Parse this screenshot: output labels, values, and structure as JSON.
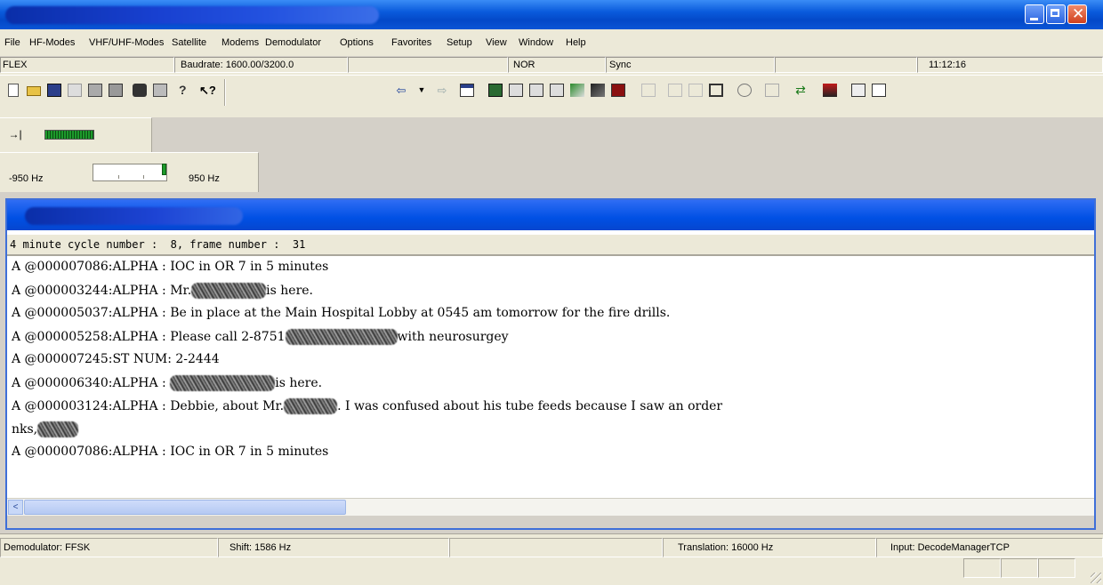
{
  "window": {
    "min_label": "minimize",
    "max_label": "maximize",
    "close_label": "close",
    "close_glyph": "✕"
  },
  "menu": [
    "File",
    "HF-Modes",
    "VHF/UHF-Modes",
    "Satellite",
    "Modems",
    "Demodulator",
    "Options",
    "Favorites",
    "Setup",
    "View",
    "Window",
    "Help"
  ],
  "strip": {
    "mode": "FLEX",
    "baudrate": "Baudrate: 1600.00/3200.0",
    "polarity": "NOR",
    "sync": "Sync",
    "time": "11:12:16"
  },
  "tuner": {
    "low": "-950 Hz",
    "high": "950 Hz",
    "position": 1.0
  },
  "decoder": {
    "info": "4 minute cycle number :  8, frame number :  31",
    "lines": [
      "A @000007086:ALPHA : IOC in OR 7 in 5 minutes",
      "A @000003244:ALPHA : Mr.",
      "A @000005037:ALPHA : Be in place at the Main Hospital Lobby at 0545 am tomorrow for the fire drills.",
      "A @000005258:ALPHA : Please call 2-8751",
      "A @000007245:ST NUM: 2-2444",
      "A @000006340:ALPHA : ",
      "A @000003124:ALPHA : Debbie, about Mr.",
      "nks,",
      "A @000007086:ALPHA : IOC in OR 7 in 5 minutes"
    ],
    "suffixes": {
      "l1": "is here.",
      "l3": "with neurosurgey",
      "l5": "is here.",
      "l6": ". I was confused about his tube feeds because I saw an order"
    },
    "scroll_left": "<"
  },
  "status": {
    "demodulator": "Demodulator: FFSK",
    "shift": "Shift: 1586 Hz",
    "translation": "Translation: 16000 Hz",
    "input": "Input: DecodeManagerTCP"
  },
  "colors": {
    "title_blue": "#0348c8",
    "panel": "#ece9d8",
    "level_green": "#1d9a2c"
  }
}
